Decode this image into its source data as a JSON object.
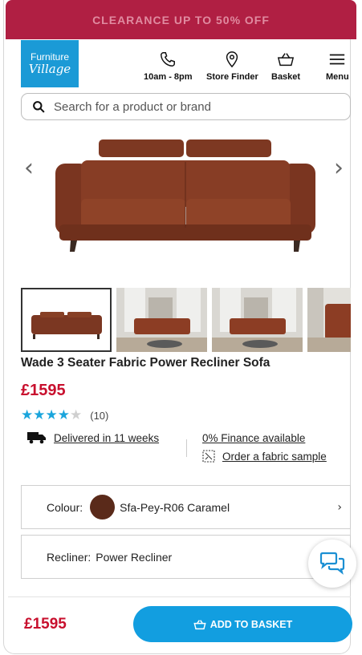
{
  "promo": {
    "text": "CLEARANCE UP TO 50% OFF"
  },
  "logo": {
    "line1": "Furniture",
    "line2": "Village"
  },
  "header": {
    "hours_label": "10am - 8pm",
    "store_finder_label": "Store Finder",
    "basket_label": "Basket",
    "menu_label": "Menu"
  },
  "search": {
    "placeholder": "Search for a product or brand"
  },
  "gallery": {
    "prev": "‹",
    "next": "›"
  },
  "product": {
    "title": "Wade 3 Seater Fabric Power Recliner Sofa",
    "price": "£1595",
    "rating": 4.5,
    "review_count": "(10)",
    "delivery": "Delivered in 11 weeks",
    "finance": "0% Finance available",
    "fabric_sample": "Order a fabric sample"
  },
  "options": {
    "colour_label": "Colour:",
    "colour_value": "Sfa-Pey-R06 Caramel",
    "colour_hex": "#5a2a1a",
    "recliner_label": "Recliner:",
    "recliner_value": "Power Recliner"
  },
  "footer": {
    "price": "£1595",
    "add_label": "ADD TO BASKET"
  },
  "colors": {
    "brand_red": "#c8102e",
    "promo_bg": "#b01f43",
    "accent_blue": "#129ee0",
    "logo_blue": "#1b9ad6",
    "star": "#1aa5dc"
  }
}
